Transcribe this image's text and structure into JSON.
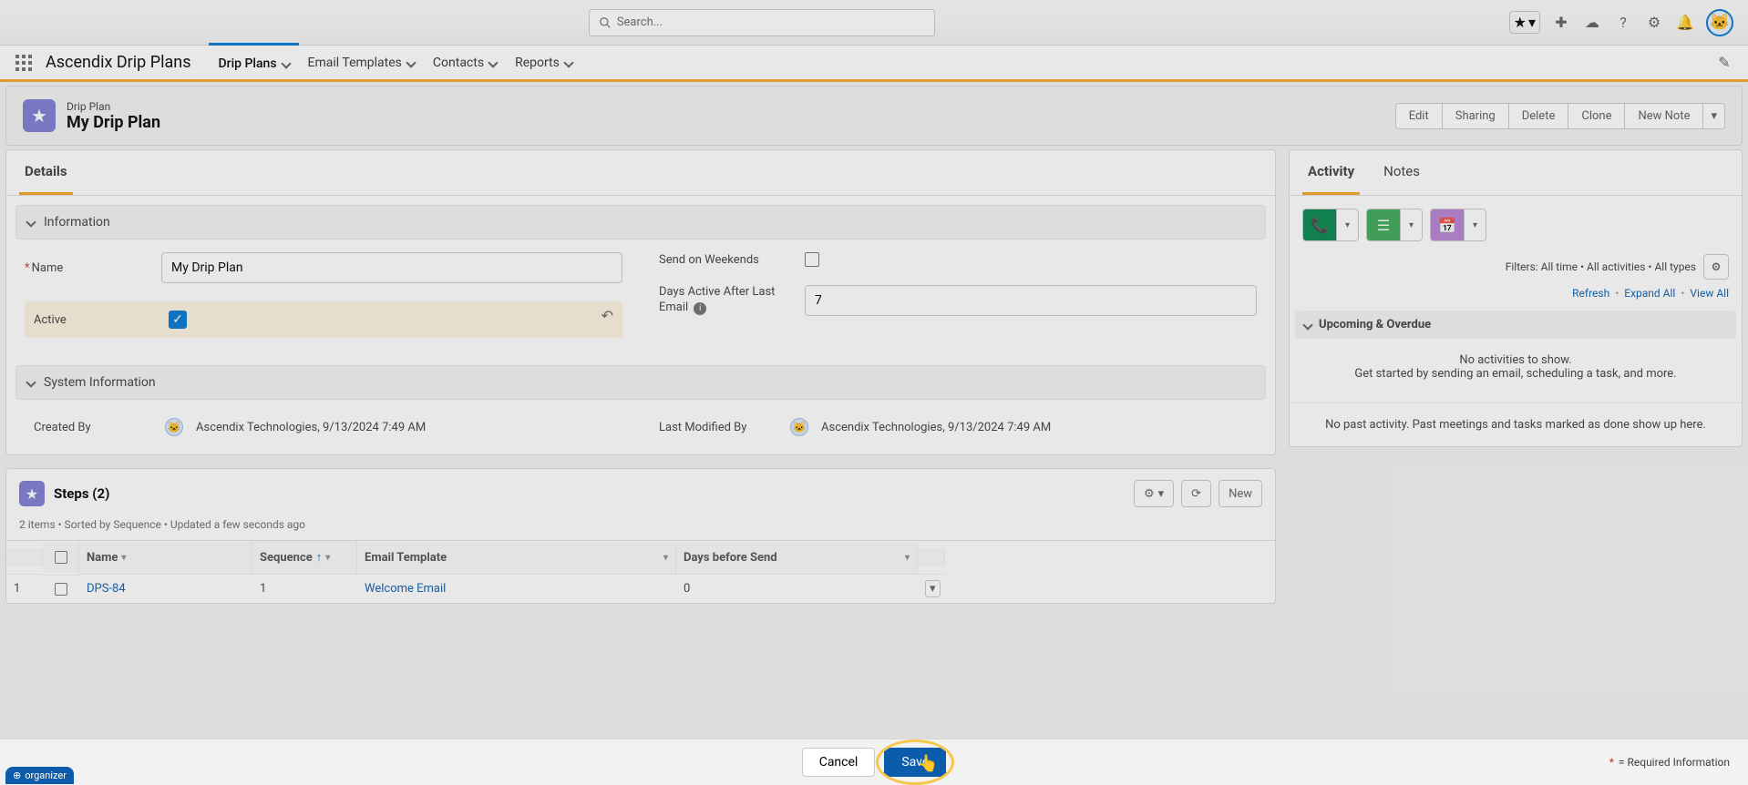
{
  "header": {
    "search_placeholder": "Search..."
  },
  "nav": {
    "app": "Ascendix Drip Plans",
    "tabs": {
      "drip": "Drip Plans",
      "email": "Email Templates",
      "contacts": "Contacts",
      "reports": "Reports"
    }
  },
  "record": {
    "entity": "Drip Plan",
    "name": "My Drip Plan",
    "actions": {
      "edit": "Edit",
      "sharing": "Sharing",
      "delete": "Delete",
      "clone": "Clone",
      "new_note": "New Note"
    }
  },
  "details": {
    "tab_label": "Details",
    "info_section": "Information",
    "name_label": "Name",
    "name_value": "My Drip Plan",
    "active_label": "Active",
    "sow_label": "Send on Weekends",
    "days_active_label": "Days Active After Last Email",
    "days_active_value": "7",
    "sys_section": "System Information",
    "created_label": "Created By",
    "created_value": "Ascendix Technologies, 9/13/2024 7:49 AM",
    "modified_label": "Last Modified By",
    "modified_value": "Ascendix Technologies, 9/13/2024 7:49 AM"
  },
  "steps": {
    "title": "Steps (2)",
    "subtitle": "2 items • Sorted by Sequence • Updated a few seconds ago",
    "new_btn": "New",
    "cols": {
      "name": "Name",
      "sequence": "Sequence",
      "template": "Email Template",
      "days": "Days before Send"
    },
    "row1": {
      "idx": "1",
      "name": "DPS-84",
      "seq": "1",
      "tpl": "Welcome Email",
      "days": "0"
    }
  },
  "footer": {
    "cancel": "Cancel",
    "save": "Save",
    "req": "= Required Information"
  },
  "activity": {
    "tab_activity": "Activity",
    "tab_notes": "Notes",
    "filters": "Filters: All time • All activities • All types",
    "refresh": "Refresh",
    "expand": "Expand All",
    "viewall": "View All",
    "upcoming": "Upcoming & Overdue",
    "empty1": "No activities to show.",
    "empty2": "Get started by sending an email, scheduling a task, and more.",
    "past": "No past activity. Past meetings and tasks marked as done show up here."
  },
  "org_tag": "organizer"
}
